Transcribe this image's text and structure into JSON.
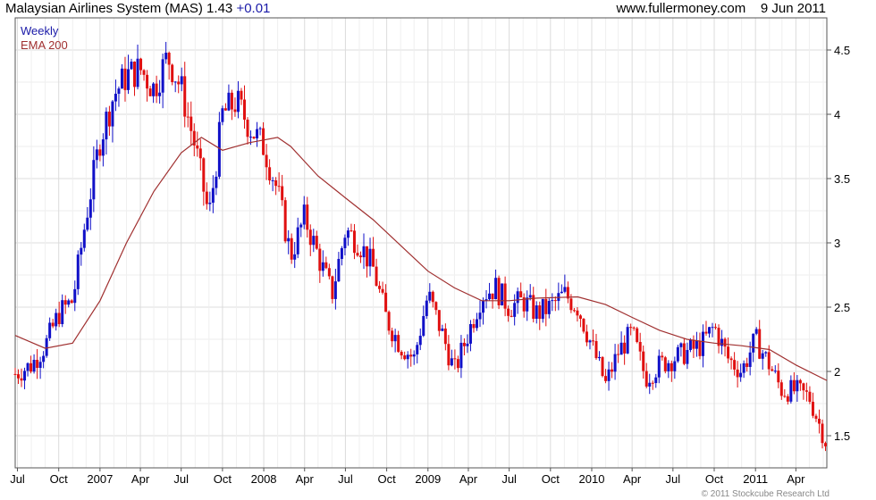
{
  "header": {
    "title": "Malaysian Airlines System (MAS) 1.43",
    "change": "+0.01",
    "source": "www.fullermoney.com",
    "date": "9 Jun 2011"
  },
  "legend": {
    "weekly": "Weekly",
    "ema": "EMA 200"
  },
  "footer": {
    "copyright": "© 2011 Stockcube Research Ltd"
  },
  "colors": {
    "up_candle": "#1010c8",
    "down_candle": "#e01010",
    "ema_line": "#a03030",
    "grid": "#dcdcdc",
    "axis": "#555555"
  },
  "chart_data": {
    "type": "candlestick",
    "title": "Malaysian Airlines System (MAS) 1.43",
    "frequency": "Weekly",
    "x_ticks": [
      "Jul",
      "Oct",
      "2007",
      "Apr",
      "Jul",
      "Oct",
      "2008",
      "Apr",
      "Jul",
      "Oct",
      "2009",
      "Apr",
      "Jul",
      "Oct",
      "2010",
      "Apr",
      "Jul",
      "Oct",
      "2011",
      "Apr"
    ],
    "y_ticks": [
      1.5,
      2,
      2.5,
      3,
      3.5,
      4,
      4.5
    ],
    "ylim": [
      1.25,
      4.75
    ],
    "x_range": [
      "2006-06-26",
      "2011-06-09"
    ],
    "grid": true,
    "legend_position": "top-left",
    "series": [
      {
        "name": "Weekly",
        "kind": "close",
        "points": [
          [
            "2006-06-26",
            1.98
          ],
          [
            "2006-08-01",
            2.05
          ],
          [
            "2006-09-01",
            2.2
          ],
          [
            "2006-10-01",
            2.45
          ],
          [
            "2006-11-01",
            2.55
          ],
          [
            "2006-12-01",
            3.2
          ],
          [
            "2007-01-01",
            3.8
          ],
          [
            "2007-02-01",
            4.15
          ],
          [
            "2007-03-01",
            4.3
          ],
          [
            "2007-04-01",
            4.35
          ],
          [
            "2007-05-01",
            4.2
          ],
          [
            "2007-06-01",
            4.45
          ],
          [
            "2007-07-01",
            4.2
          ],
          [
            "2007-08-01",
            3.75
          ],
          [
            "2007-09-01",
            3.2
          ],
          [
            "2007-10-01",
            4.0
          ],
          [
            "2007-11-01",
            4.1
          ],
          [
            "2007-12-01",
            3.9
          ],
          [
            "2008-01-01",
            3.75
          ],
          [
            "2008-02-01",
            3.4
          ],
          [
            "2008-03-01",
            2.9
          ],
          [
            "2008-04-01",
            3.2
          ],
          [
            "2008-05-01",
            2.9
          ],
          [
            "2008-06-01",
            2.6
          ],
          [
            "2008-07-01",
            3.1
          ],
          [
            "2008-08-01",
            3.0
          ],
          [
            "2008-09-01",
            2.8
          ],
          [
            "2008-10-01",
            2.4
          ],
          [
            "2008-11-01",
            2.2
          ],
          [
            "2008-12-01",
            2.1
          ],
          [
            "2009-01-01",
            2.6
          ],
          [
            "2009-02-01",
            2.3
          ],
          [
            "2009-03-01",
            2.0
          ],
          [
            "2009-04-01",
            2.3
          ],
          [
            "2009-05-01",
            2.6
          ],
          [
            "2009-06-01",
            2.65
          ],
          [
            "2009-07-01",
            2.5
          ],
          [
            "2009-08-01",
            2.55
          ],
          [
            "2009-09-01",
            2.45
          ],
          [
            "2009-10-01",
            2.5
          ],
          [
            "2009-11-01",
            2.6
          ],
          [
            "2009-12-01",
            2.5
          ],
          [
            "2010-01-01",
            2.2
          ],
          [
            "2010-02-01",
            1.9
          ],
          [
            "2010-03-01",
            2.15
          ],
          [
            "2010-04-01",
            2.3
          ],
          [
            "2010-05-01",
            1.95
          ],
          [
            "2010-06-01",
            2.05
          ],
          [
            "2010-07-01",
            2.1
          ],
          [
            "2010-08-01",
            2.15
          ],
          [
            "2010-09-01",
            2.2
          ],
          [
            "2010-10-01",
            2.35
          ],
          [
            "2010-11-01",
            2.1
          ],
          [
            "2010-12-01",
            2.0
          ],
          [
            "2011-01-01",
            2.25
          ],
          [
            "2011-02-01",
            2.05
          ],
          [
            "2011-03-01",
            1.85
          ],
          [
            "2011-04-01",
            1.85
          ],
          [
            "2011-05-01",
            1.8
          ],
          [
            "2011-06-09",
            1.43
          ]
        ]
      },
      {
        "name": "EMA 200",
        "kind": "line",
        "points": [
          [
            "2006-06-26",
            2.28
          ],
          [
            "2006-09-01",
            2.18
          ],
          [
            "2006-11-01",
            2.22
          ],
          [
            "2007-01-01",
            2.55
          ],
          [
            "2007-03-01",
            3.0
          ],
          [
            "2007-05-01",
            3.4
          ],
          [
            "2007-07-01",
            3.7
          ],
          [
            "2007-08-15",
            3.82
          ],
          [
            "2007-10-01",
            3.72
          ],
          [
            "2007-12-01",
            3.78
          ],
          [
            "2008-02-01",
            3.82
          ],
          [
            "2008-03-01",
            3.75
          ],
          [
            "2008-05-01",
            3.52
          ],
          [
            "2008-07-01",
            3.35
          ],
          [
            "2008-09-01",
            3.18
          ],
          [
            "2008-11-01",
            2.98
          ],
          [
            "2009-01-01",
            2.78
          ],
          [
            "2009-03-01",
            2.65
          ],
          [
            "2009-05-01",
            2.55
          ],
          [
            "2009-07-01",
            2.55
          ],
          [
            "2009-09-01",
            2.57
          ],
          [
            "2009-12-01",
            2.58
          ],
          [
            "2010-02-01",
            2.52
          ],
          [
            "2010-04-01",
            2.42
          ],
          [
            "2010-06-01",
            2.32
          ],
          [
            "2010-08-01",
            2.25
          ],
          [
            "2010-10-01",
            2.22
          ],
          [
            "2010-12-01",
            2.2
          ],
          [
            "2011-02-01",
            2.17
          ],
          [
            "2011-04-01",
            2.05
          ],
          [
            "2011-06-09",
            1.93
          ]
        ]
      }
    ]
  }
}
